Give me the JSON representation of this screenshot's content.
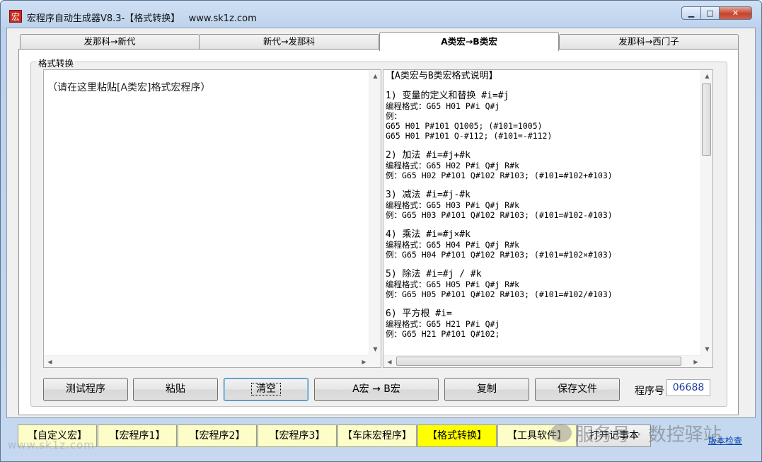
{
  "window": {
    "title": "宏程序自动生成器V8.3-【格式转换】   www.sk1z.com",
    "icon_char": "宏",
    "btn_minimize": "▁",
    "btn_maximize": "□",
    "btn_close": "✕"
  },
  "tabs": [
    {
      "label": "发那科→新代",
      "active": false
    },
    {
      "label": "新代→发那科",
      "active": false
    },
    {
      "label": "A类宏→B类宏",
      "active": true
    },
    {
      "label": "发那科→西门子",
      "active": false
    }
  ],
  "group_label": "格式转换",
  "left_box": {
    "placeholder": "（请在这里粘贴[A类宏]格式宏程序）"
  },
  "right_box": {
    "lines": [
      "【A类宏与B类宏格式说明】",
      "",
      "1) 变量的定义和替换 #i=#j",
      "编程格式：G65 H01 P#i Q#j",
      "例：",
      "G65 H01 P#101 Q1005; (#101=1005)",
      "G65 H01 P#101 Q-#112; (#101=-#112)",
      "",
      "2) 加法 #i=#j+#k",
      "编程格式：G65 H02 P#i Q#j R#k",
      "例：G65 H02 P#101 Q#102 R#103; (#101=#102+#103)",
      "",
      "3) 减法 #i=#j-#k",
      "编程格式：G65 H03 P#i Q#j R#k",
      "例：G65 H03 P#101 Q#102 R#103; (#101=#102-#103)",
      "",
      "4) 乘法 #i=#j×#k",
      "编程格式：G65 H04 P#i Q#j R#k",
      "例：G65 H04 P#101 Q#102 R#103; (#101=#102×#103)",
      "",
      "5) 除法 #i=#j / #k",
      "编程格式：G65 H05 P#i Q#j R#k",
      "例：G65 H05 P#101 Q#102 R#103; (#101=#102/#103)",
      "",
      "6) 平方根 #i=",
      "编程格式：G65 H21 P#i Q#j",
      "例：G65 H21 P#101 Q#102;"
    ]
  },
  "buttons": {
    "test": "测试程序",
    "paste": "粘贴",
    "clear": "清空",
    "convert": "A宏 → B宏",
    "copy": "复制",
    "save": "保存文件"
  },
  "program": {
    "label": "程序号",
    "value": "06688"
  },
  "bottom_nav": [
    {
      "label": "【自定义宏】",
      "active": false
    },
    {
      "label": "【宏程序1】",
      "active": false
    },
    {
      "label": "【宏程序2】",
      "active": false
    },
    {
      "label": "【宏程序3】",
      "active": false
    },
    {
      "label": "【车床宏程序】",
      "active": false
    },
    {
      "label": "【格式转换】",
      "active": true
    },
    {
      "label": "【工具软件】",
      "active": false
    }
  ],
  "notepad_button": "打开记事本",
  "version_link": "版本检查",
  "watermarks": {
    "site": "www.sk1z.com",
    "wechat": "服务号 · 数控驿站"
  }
}
